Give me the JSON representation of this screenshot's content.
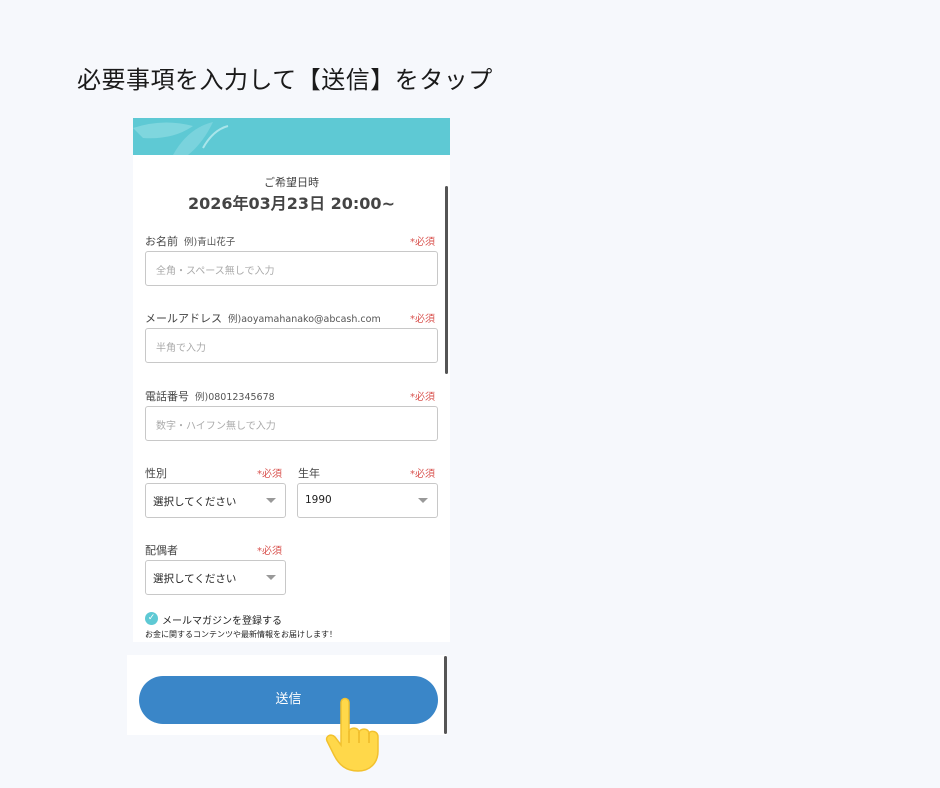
{
  "instruction": "必要事項を入力して【送信】をタップ",
  "colors": {
    "accent": "#5ec9d4",
    "button": "#3a86c8",
    "required": "#d9534f"
  },
  "reservation": {
    "label": "ご希望日時",
    "datetime": "2026年03月23日 20:00~"
  },
  "form": {
    "name": {
      "label": "お名前",
      "example": "例)青山花子",
      "required": "*必須",
      "placeholder": "全角・スペース無しで入力"
    },
    "email": {
      "label": "メールアドレス",
      "example": "例)aoyamahanako@abcash.com",
      "required": "*必須",
      "placeholder": "半角で入力"
    },
    "phone": {
      "label": "電話番号",
      "example": "例)08012345678",
      "required": "*必須",
      "placeholder": "数字・ハイフン無しで入力"
    },
    "gender": {
      "label": "性別",
      "required": "*必須",
      "value": "選択してください"
    },
    "birth_year": {
      "label": "生年",
      "required": "*必須",
      "value": "1990"
    },
    "spouse": {
      "label": "配偶者",
      "required": "*必須",
      "value": "選択してください"
    },
    "newsletter": {
      "label": "メールマガジンを登録する",
      "note": "お金に関するコンテンツや最新情報をお届けします！",
      "checked": true
    }
  },
  "submit_label": "送信",
  "icons": {
    "check": "check-icon",
    "pointer": "pointing-hand-icon"
  }
}
